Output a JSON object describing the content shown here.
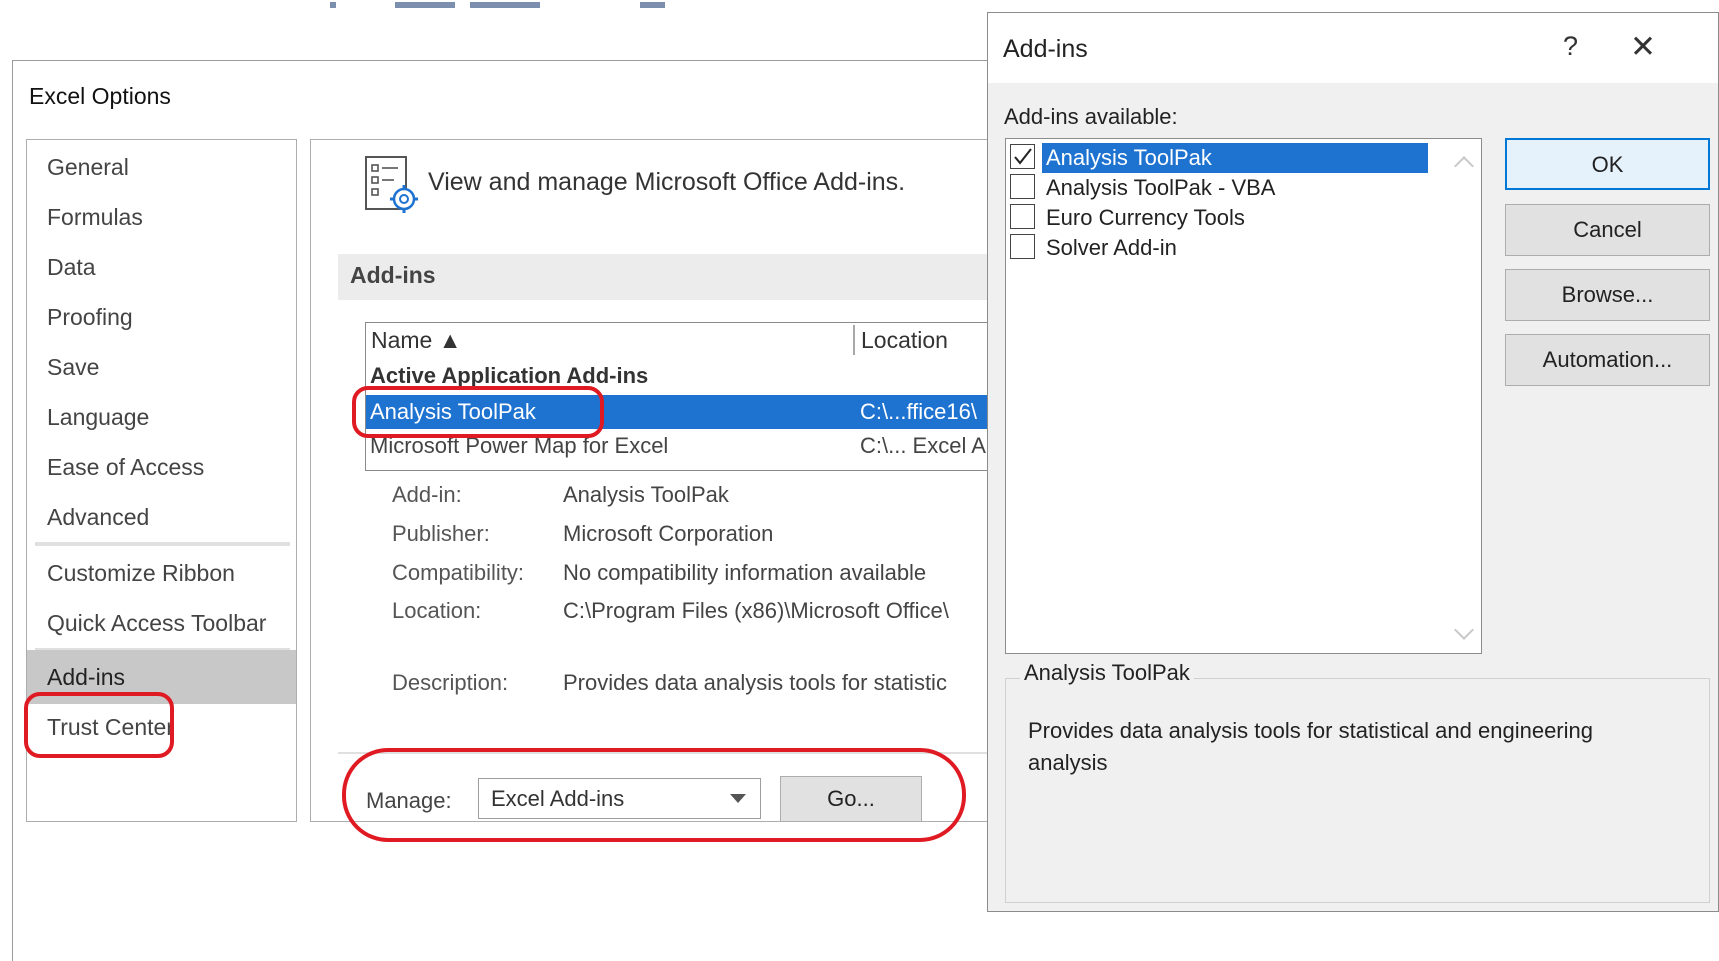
{
  "excel_options": {
    "window_title": "Excel Options",
    "nav_items": [
      {
        "label": "General"
      },
      {
        "label": "Formulas"
      },
      {
        "label": "Data"
      },
      {
        "label": "Proofing"
      },
      {
        "label": "Save"
      },
      {
        "label": "Language"
      },
      {
        "label": "Ease of Access"
      },
      {
        "label": "Advanced"
      },
      {
        "label": "Customize Ribbon"
      },
      {
        "label": "Quick Access Toolbar"
      },
      {
        "label": "Add-ins"
      },
      {
        "label": "Trust Center"
      }
    ],
    "selected_nav": "Add-ins",
    "header_text": "View and manage Microsoft Office Add-ins.",
    "section_label": "Add-ins",
    "list": {
      "columns": [
        "Name ▲",
        "Location"
      ],
      "group_label": "Active Application Add-ins",
      "rows": [
        {
          "name": "Analysis ToolPak",
          "location": "C:\\...ffice16\\"
        },
        {
          "name": "Microsoft Power Map for Excel",
          "location": "C:\\... Excel A"
        }
      ]
    },
    "details": {
      "addin_label": "Add-in:",
      "addin_value": "Analysis ToolPak",
      "publisher_label": "Publisher:",
      "publisher_value": "Microsoft Corporation",
      "compat_label": "Compatibility:",
      "compat_value": "No compatibility information available",
      "location_label": "Location:",
      "location_value": "C:\\Program Files (x86)\\Microsoft Office\\",
      "desc_label": "Description:",
      "desc_value": "Provides data analysis tools for statistic"
    },
    "manage": {
      "label": "Manage:",
      "selected": "Excel Add-ins",
      "go_label": "Go..."
    }
  },
  "addins_dialog": {
    "title": "Add-ins",
    "help_glyph": "?",
    "close_glyph": "✕",
    "available_label": "Add-ins available:",
    "items": [
      {
        "label": "Analysis ToolPak",
        "checked": true
      },
      {
        "label": "Analysis ToolPak - VBA",
        "checked": false
      },
      {
        "label": "Euro Currency Tools",
        "checked": false
      },
      {
        "label": "Solver Add-in",
        "checked": false
      }
    ],
    "buttons": {
      "ok": "OK",
      "cancel": "Cancel",
      "browse": "Browse...",
      "automation": "Automation..."
    },
    "description_title": "Analysis ToolPak",
    "description_text": "Provides data analysis tools for statistical and engineering analysis"
  },
  "colors": {
    "selection_blue": "#1e73d1",
    "highlight_red": "#e01a22",
    "nav_selected_gray": "#c8c8c8"
  }
}
